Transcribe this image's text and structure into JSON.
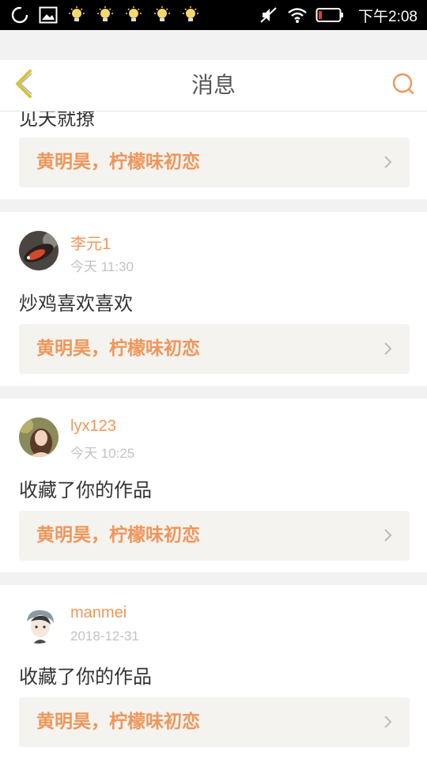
{
  "status_bar": {
    "time": "下午2:08",
    "icons_left": [
      "loading-icon",
      "image-icon",
      "lightbulb-icon",
      "lightbulb-icon",
      "lightbulb-icon",
      "lightbulb-icon",
      "lightbulb-icon"
    ],
    "icons_right": [
      "mute-icon",
      "wifi-icon",
      "battery-low-icon"
    ],
    "colors": {
      "bar": "#000000",
      "battery_low": "#e53935"
    }
  },
  "header": {
    "title": "消息",
    "back_icon": "chevron-left-icon",
    "search_icon": "search-icon",
    "colors": {
      "back": "#d6c23a",
      "search": "#f0965a"
    }
  },
  "messages": [
    {
      "message": "见天就撩",
      "work_title": "黄明昊，柠檬味初恋"
    },
    {
      "username": "李元1",
      "time": "今天 11:30",
      "message": "炒鸡喜欢喜欢",
      "work_title": "黄明昊，柠檬味初恋",
      "avatar": "avatar-fish"
    },
    {
      "username": "lyx123",
      "time": "今天 10:25",
      "message": "收藏了你的作品",
      "work_title": "黄明昊，柠檬味初恋",
      "avatar": "avatar-girl"
    },
    {
      "username": "manmei",
      "time": "2018-12-31",
      "message": "收藏了你的作品",
      "work_title": "黄明昊，柠檬味初恋",
      "avatar": "avatar-anime"
    }
  ],
  "theme": {
    "accent": "#f0965a",
    "work_bg": "#f4f3ef",
    "divider_bg": "#f2f2f2",
    "text_primary": "#333333",
    "text_secondary": "#c2c2c2"
  }
}
